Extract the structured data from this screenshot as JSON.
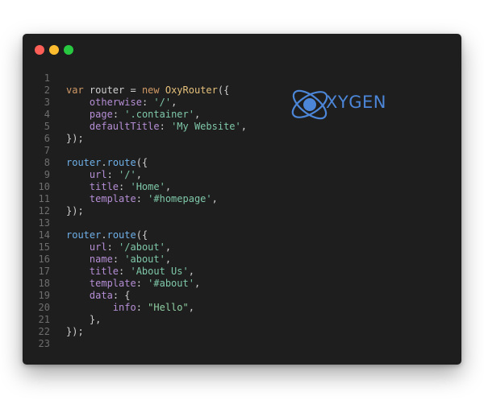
{
  "window": {
    "controls": [
      {
        "name": "close",
        "color": "#ff5f57"
      },
      {
        "name": "minimize",
        "color": "#febc2e"
      },
      {
        "name": "maximize",
        "color": "#28c840"
      }
    ]
  },
  "logo": {
    "text": "XYGEN",
    "color": "#4c86d8",
    "icon": "atom-orbit-o-icon"
  },
  "code": {
    "lines": [
      {
        "n": "1",
        "t": []
      },
      {
        "n": "2",
        "t": [
          [
            "kw",
            "var"
          ],
          [
            "punc",
            " router = "
          ],
          [
            "kw",
            "new"
          ],
          [
            "punc",
            " "
          ],
          [
            "cls",
            "OxyRouter"
          ],
          [
            "punc",
            "({"
          ]
        ]
      },
      {
        "n": "3",
        "t": [
          [
            "punc",
            "    "
          ],
          [
            "prop",
            "otherwise"
          ],
          [
            "punc",
            ": "
          ],
          [
            "str",
            "'/'"
          ],
          [
            "punc",
            ","
          ]
        ]
      },
      {
        "n": "4",
        "t": [
          [
            "punc",
            "    "
          ],
          [
            "prop",
            "page"
          ],
          [
            "punc",
            ": "
          ],
          [
            "str",
            "'.container'"
          ],
          [
            "punc",
            ","
          ]
        ]
      },
      {
        "n": "5",
        "t": [
          [
            "punc",
            "    "
          ],
          [
            "prop",
            "defaultTitle"
          ],
          [
            "punc",
            ": "
          ],
          [
            "str",
            "'My Website'"
          ],
          [
            "punc",
            ","
          ]
        ]
      },
      {
        "n": "6",
        "t": [
          [
            "punc",
            "});"
          ]
        ]
      },
      {
        "n": "7",
        "t": []
      },
      {
        "n": "8",
        "t": [
          [
            "fn",
            "router"
          ],
          [
            "punc",
            "."
          ],
          [
            "fn",
            "route"
          ],
          [
            "punc",
            "({"
          ]
        ]
      },
      {
        "n": "9",
        "t": [
          [
            "punc",
            "    "
          ],
          [
            "prop",
            "url"
          ],
          [
            "punc",
            ": "
          ],
          [
            "str",
            "'/'"
          ],
          [
            "punc",
            ","
          ]
        ]
      },
      {
        "n": "10",
        "t": [
          [
            "punc",
            "    "
          ],
          [
            "prop",
            "title"
          ],
          [
            "punc",
            ": "
          ],
          [
            "str",
            "'Home'"
          ],
          [
            "punc",
            ","
          ]
        ]
      },
      {
        "n": "11",
        "t": [
          [
            "punc",
            "    "
          ],
          [
            "prop",
            "template"
          ],
          [
            "punc",
            ": "
          ],
          [
            "str",
            "'#homepage'"
          ],
          [
            "punc",
            ","
          ]
        ]
      },
      {
        "n": "12",
        "t": [
          [
            "punc",
            "});"
          ]
        ]
      },
      {
        "n": "13",
        "t": []
      },
      {
        "n": "14",
        "t": [
          [
            "fn",
            "router"
          ],
          [
            "punc",
            "."
          ],
          [
            "fn",
            "route"
          ],
          [
            "punc",
            "({"
          ]
        ]
      },
      {
        "n": "15",
        "t": [
          [
            "punc",
            "    "
          ],
          [
            "prop",
            "url"
          ],
          [
            "punc",
            ": "
          ],
          [
            "str",
            "'/about'"
          ],
          [
            "punc",
            ","
          ]
        ]
      },
      {
        "n": "16",
        "t": [
          [
            "punc",
            "    "
          ],
          [
            "prop",
            "name"
          ],
          [
            "punc",
            ": "
          ],
          [
            "str",
            "'about'"
          ],
          [
            "punc",
            ","
          ]
        ]
      },
      {
        "n": "17",
        "t": [
          [
            "punc",
            "    "
          ],
          [
            "prop",
            "title"
          ],
          [
            "punc",
            ": "
          ],
          [
            "str",
            "'About Us'"
          ],
          [
            "punc",
            ","
          ]
        ]
      },
      {
        "n": "18",
        "t": [
          [
            "punc",
            "    "
          ],
          [
            "prop",
            "template"
          ],
          [
            "punc",
            ": "
          ],
          [
            "str",
            "'#about'"
          ],
          [
            "punc",
            ","
          ]
        ]
      },
      {
        "n": "19",
        "t": [
          [
            "punc",
            "    "
          ],
          [
            "prop",
            "data"
          ],
          [
            "punc",
            ": {"
          ]
        ]
      },
      {
        "n": "20",
        "t": [
          [
            "punc",
            "        "
          ],
          [
            "prop",
            "info"
          ],
          [
            "punc",
            ": "
          ],
          [
            "str2",
            "\"Hello\""
          ],
          [
            "punc",
            ","
          ]
        ]
      },
      {
        "n": "21",
        "t": [
          [
            "punc",
            "    },"
          ]
        ]
      },
      {
        "n": "22",
        "t": [
          [
            "punc",
            "});"
          ]
        ]
      },
      {
        "n": "23",
        "t": []
      }
    ]
  }
}
